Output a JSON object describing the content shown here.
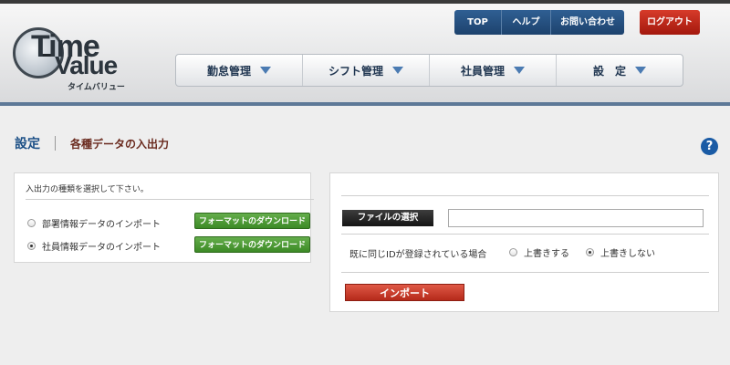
{
  "header": {
    "logo": {
      "line1": "Time",
      "line2": "Value",
      "sub": "タイムバリュー"
    },
    "top_links": [
      {
        "label": "TOP"
      },
      {
        "label": "ヘルプ"
      },
      {
        "label": "お問い合わせ"
      }
    ],
    "logout_label": "ログアウト",
    "nav": [
      {
        "label": "勤怠管理"
      },
      {
        "label": "シフト管理"
      },
      {
        "label": "社員管理"
      },
      {
        "label": "設　定"
      }
    ]
  },
  "page": {
    "title": "設定",
    "subtitle": "各種データの入出力",
    "help_glyph": "?"
  },
  "left_panel": {
    "heading": "入出力の種類を選択して下さい。",
    "options": [
      {
        "label": "部署情報データのインポート",
        "checked": false,
        "button": "フォーマットのダウンロード"
      },
      {
        "label": "社員情報データのインポート",
        "checked": true,
        "button": "フォーマットのダウンロード"
      }
    ]
  },
  "right_panel": {
    "file_select_label": "ファイルの選択",
    "file_value": "",
    "duplicate_label": "既に同じIDが登録されている場合",
    "overwrite_options": [
      {
        "label": "上書きする",
        "checked": false
      },
      {
        "label": "上書きしない",
        "checked": true
      }
    ],
    "import_label": "インポート"
  },
  "colors": {
    "nav_text": "#1f3550",
    "title_blue": "#1b4f86",
    "subtitle_brown": "#6a2a1e",
    "logout_red": "#c02a1c",
    "download_green": "#4f9c37",
    "import_red": "#c83a28"
  }
}
